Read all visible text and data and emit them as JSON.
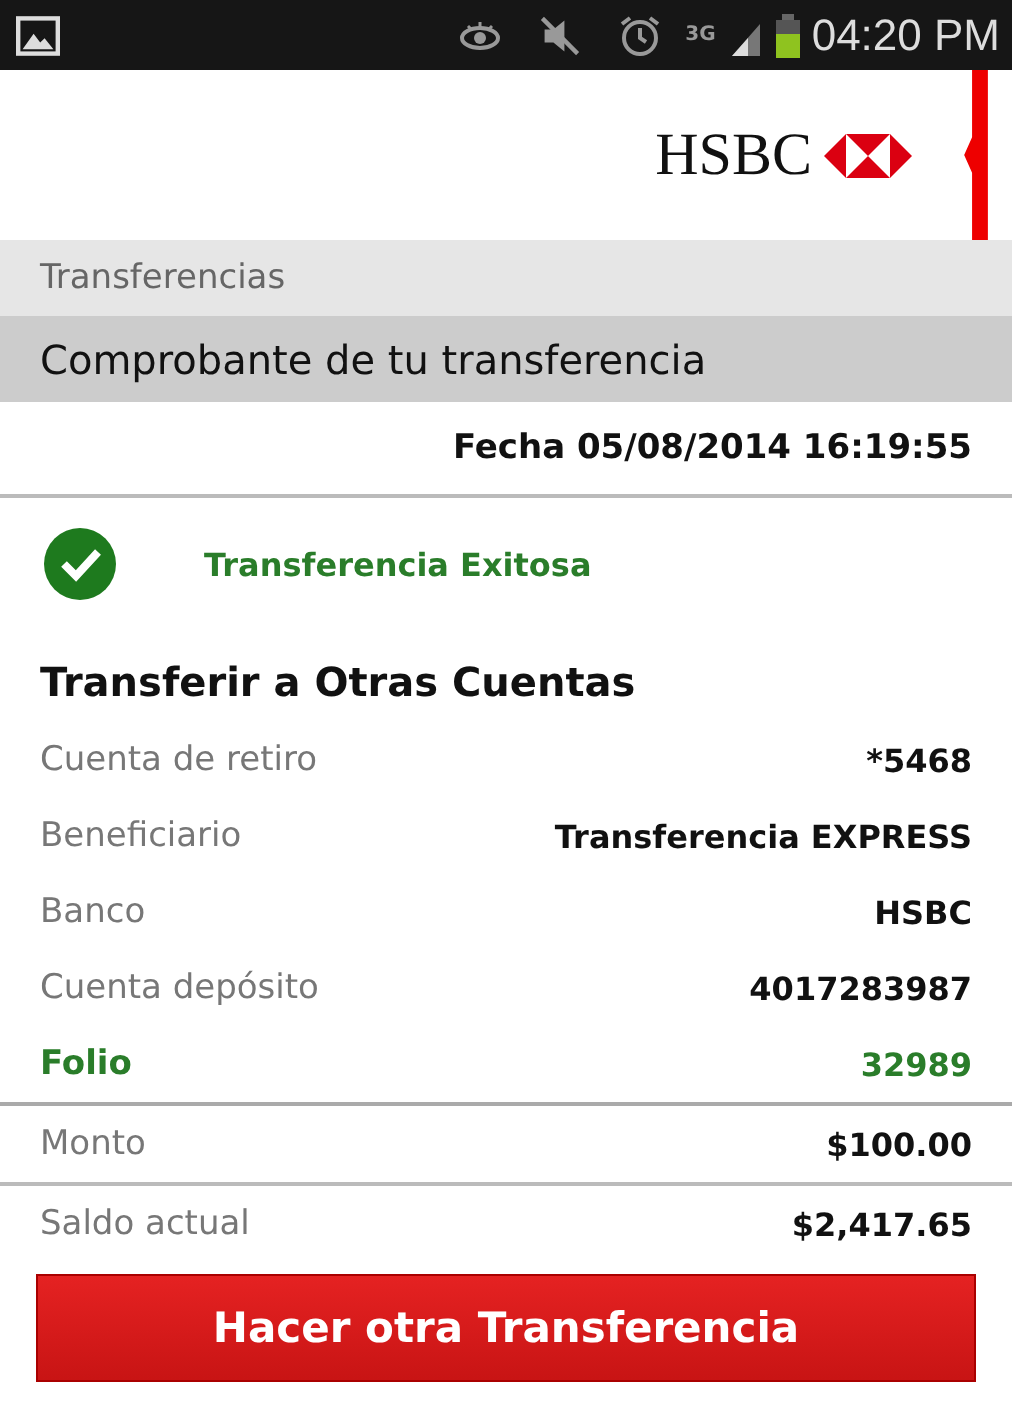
{
  "status_bar": {
    "network": "3G",
    "time": "04:20 PM"
  },
  "header": {
    "logo_text": "HSBC"
  },
  "breadcrumb": "Transferencias",
  "title": "Comprobante de tu transferencia",
  "date": "Fecha 05/08/2014 16:19:55",
  "result": {
    "message": "Transferencia Exitosa",
    "success": true
  },
  "section_title": "Transferir a Otras Cuentas",
  "rows": [
    {
      "kind": "detail",
      "label": "Cuenta de retiro",
      "value": "*5468"
    },
    {
      "kind": "detail",
      "label": "Beneficiario",
      "value": "Transferencia EXPRESS"
    },
    {
      "kind": "detail",
      "label": "Banco",
      "value": "HSBC"
    },
    {
      "kind": "detail",
      "label": "Cuenta depósito",
      "value": "4017283987"
    },
    {
      "kind": "highlight",
      "label": "Folio",
      "value": "32989"
    },
    {
      "kind": "total",
      "label": "Monto",
      "value": "$100.00"
    },
    {
      "kind": "total",
      "label": "Saldo actual",
      "value": "$2,417.65"
    }
  ],
  "button": "Hacer otra Transferencia"
}
